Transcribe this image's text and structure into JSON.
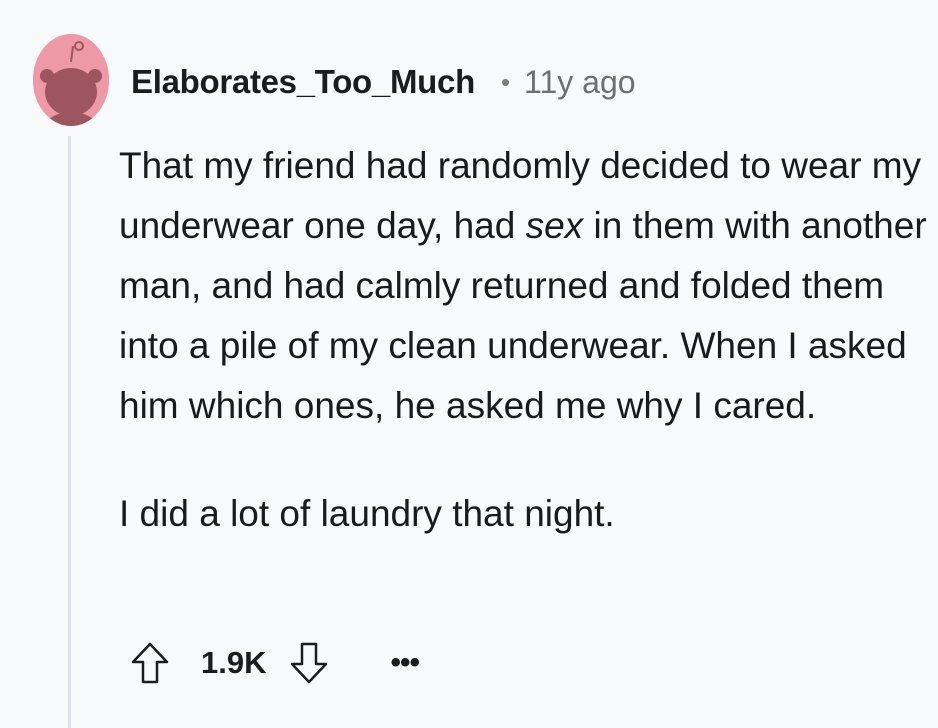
{
  "comment": {
    "avatar": {
      "icon": "snoo-avatar-icon",
      "color": "#ee9aa6"
    },
    "username": "Elaborates_Too_Much",
    "separator": "•",
    "age": "11y ago",
    "paragraph_1": "That my friend had randomly decided to wear my underwear one day, had ",
    "emphasis": "sex",
    "paragraph_1_rest": " in them with another man, and had calmly returned and folded them into a pile of my clean underwear. When I asked him which ones, he asked me why I cared.",
    "paragraph_2": "I did a lot of laundry that night.",
    "actions": {
      "upvote_icon": "arrow-up-icon",
      "score": "1.9K",
      "downvote_icon": "arrow-down-icon",
      "more_label": "•••"
    }
  }
}
